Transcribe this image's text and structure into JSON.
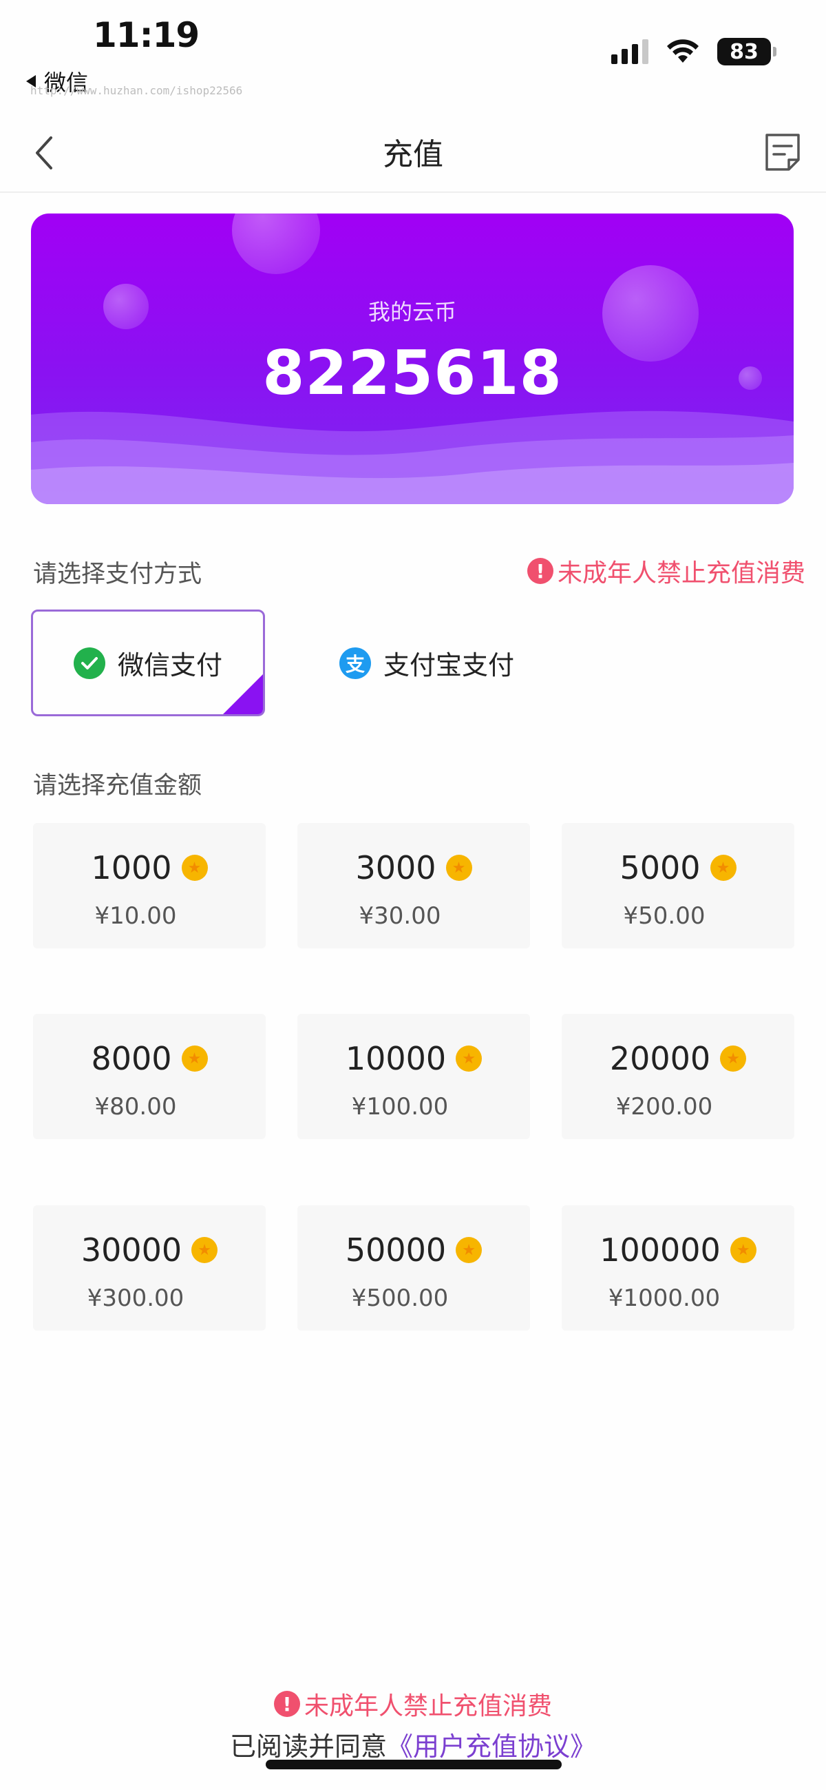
{
  "status_bar": {
    "time": "11:19",
    "back_app": "微信",
    "watermark": "http://www.huzhan.com/ishop22566",
    "battery": "83"
  },
  "nav": {
    "title": "充值",
    "back_icon": "chevron-left-icon",
    "record_icon": "document-icon"
  },
  "balance": {
    "label": "我的云币",
    "value": "8225618"
  },
  "payment": {
    "section_label": "请选择支付方式",
    "warning": "未成年人禁止充值消费",
    "options": [
      {
        "label": "微信支付",
        "selected": true,
        "icon": "wechat-pay-icon",
        "color": "#22b14c"
      },
      {
        "label": "支付宝支付",
        "selected": false,
        "icon": "alipay-icon",
        "color": "#1e9bf0",
        "glyph": "支"
      }
    ]
  },
  "amounts": {
    "section_label": "请选择充值金额",
    "items": [
      {
        "coins": "1000",
        "price": "¥10.00"
      },
      {
        "coins": "3000",
        "price": "¥30.00"
      },
      {
        "coins": "5000",
        "price": "¥50.00"
      },
      {
        "coins": "8000",
        "price": "¥80.00"
      },
      {
        "coins": "10000",
        "price": "¥100.00"
      },
      {
        "coins": "20000",
        "price": "¥200.00"
      },
      {
        "coins": "30000",
        "price": "¥300.00"
      },
      {
        "coins": "50000",
        "price": "¥500.00"
      },
      {
        "coins": "100000",
        "price": "¥1000.00"
      }
    ]
  },
  "footer": {
    "warning": "未成年人禁止充值消费",
    "agree_prefix": "已阅读并同意",
    "agree_link": "《用户充值协议》"
  },
  "colors": {
    "accent": "#8a12f2",
    "warning": "#f0506e",
    "link": "#7b3fd0"
  }
}
